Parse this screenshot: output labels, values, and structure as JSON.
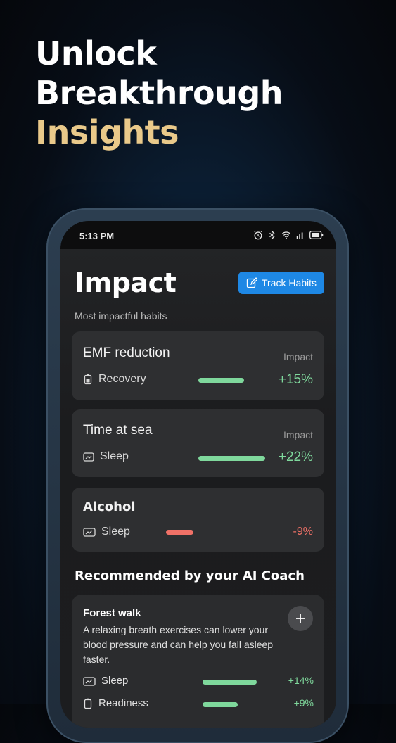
{
  "headline": {
    "line1": "Unlock",
    "line2": "Breakthrough",
    "line3": "Insights"
  },
  "status": {
    "time": "5:13 PM"
  },
  "page": {
    "title": "Impact",
    "subtitle": "Most impactful habits",
    "track_button": "Track Habits"
  },
  "impact_cards": [
    {
      "name": "EMF reduction",
      "impact_label": "Impact",
      "category": "Recovery",
      "value": "+15%",
      "level": 0.15,
      "color": "#7fd89c"
    },
    {
      "name": "Time at sea",
      "impact_label": "Impact",
      "category": "Sleep",
      "value": "+22%",
      "level": 0.22,
      "color": "#7fd89c"
    },
    {
      "name": "Alcohol",
      "category": "Sleep",
      "value": "-9%",
      "level": -0.09,
      "color": "#f07167"
    }
  ],
  "recommended": {
    "heading": "Recommended by your AI Coach",
    "item": {
      "name": "Forest walk",
      "description": "A relaxing breath exercises can lower your blood pressure and can help you fall asleep faster.",
      "add_icon": "plus-icon",
      "rows": [
        {
          "category": "Sleep",
          "value": "+14%",
          "level": 0.14
        },
        {
          "category": "Readiness",
          "value": "+9%",
          "level": 0.09
        }
      ]
    }
  }
}
